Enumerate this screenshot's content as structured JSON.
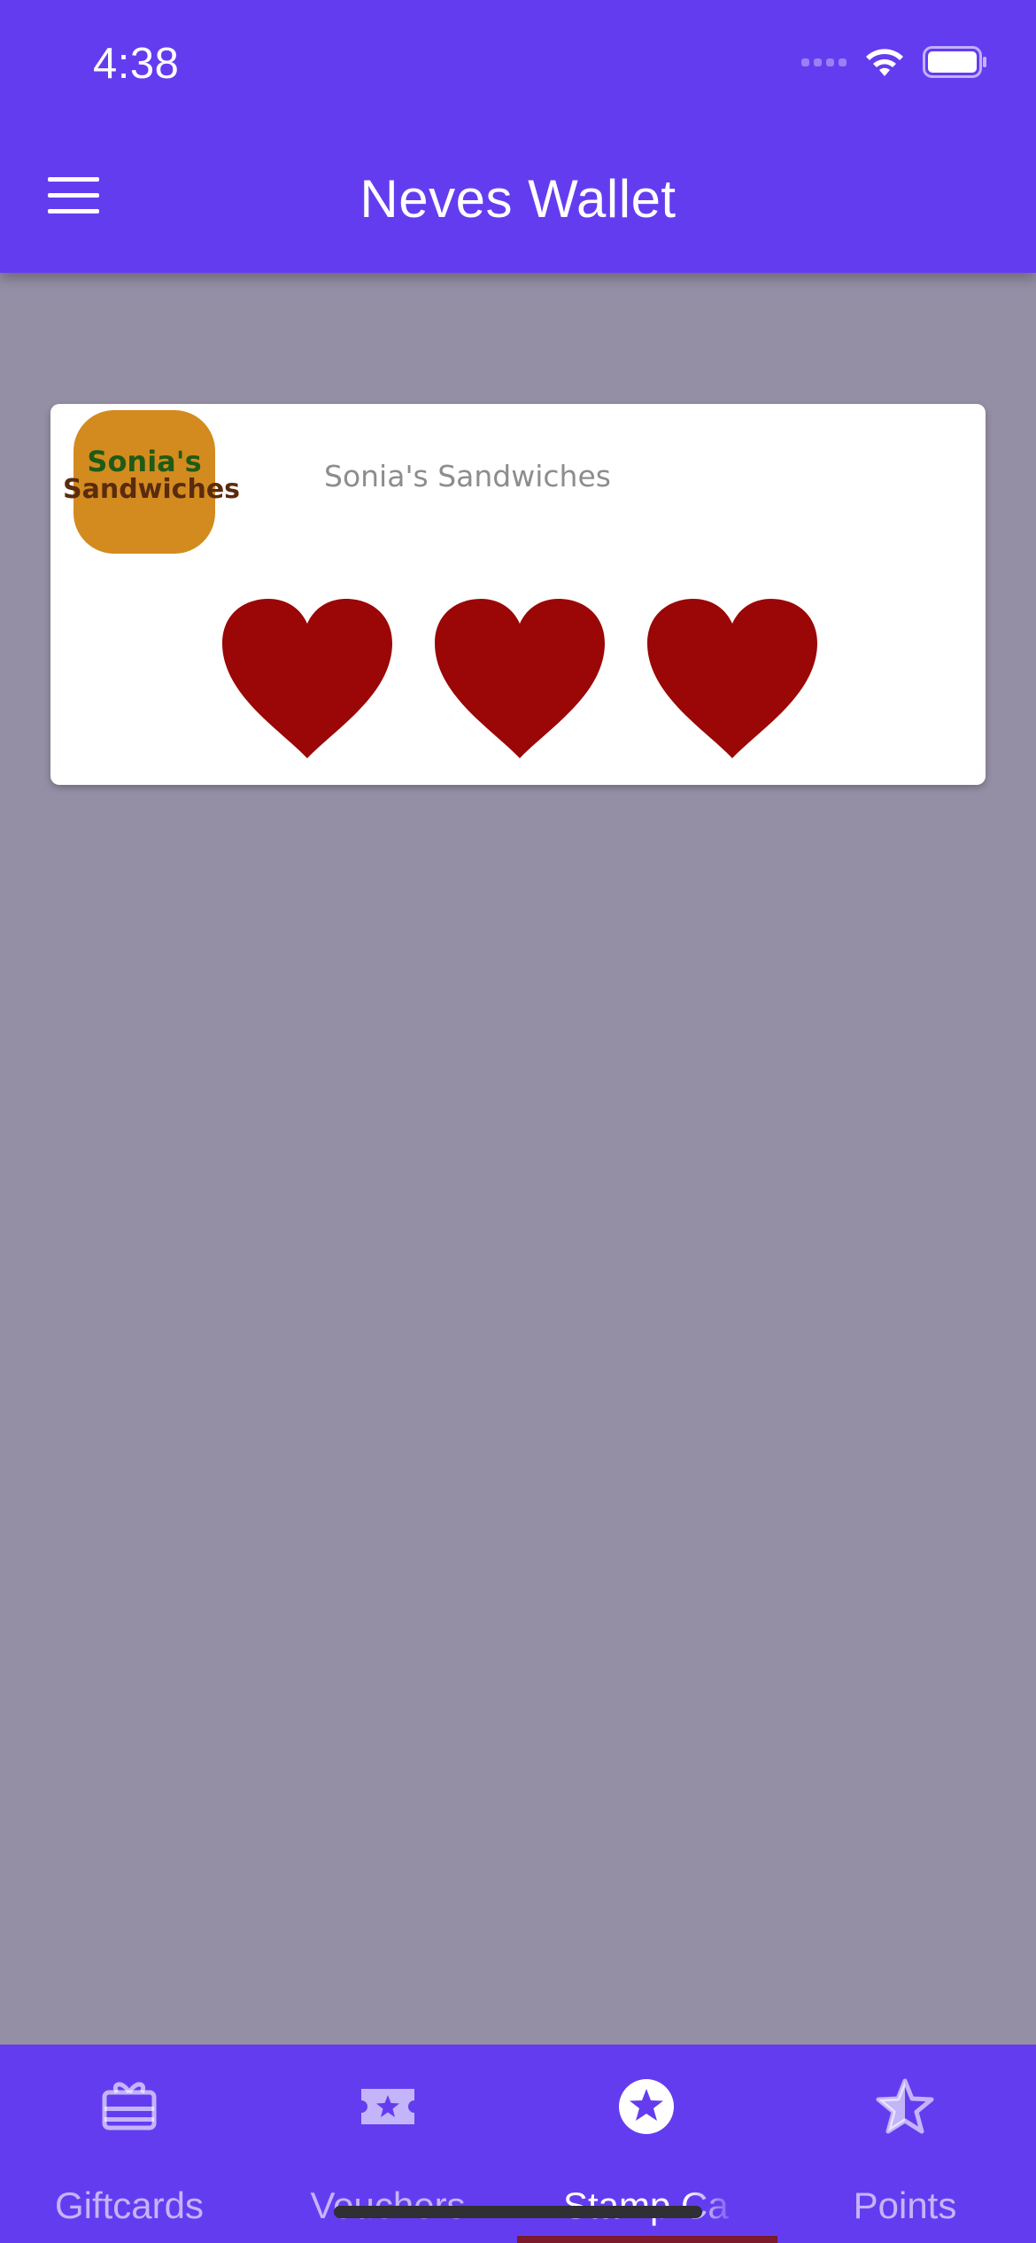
{
  "status_bar": {
    "time": "4:38"
  },
  "app_bar": {
    "title": "Neves Wallet",
    "menu_icon": "hamburger-menu-icon"
  },
  "stamp_cards": [
    {
      "merchant_name": "Sonia's Sandwiches",
      "logo_lines": [
        "Sonia's",
        "Sandwiches"
      ],
      "logo_color": "#d38b20",
      "stamp_icon": "heart-icon",
      "stamp_color": "#9b0606",
      "stamps_collected": 3
    }
  ],
  "bottom_nav": {
    "items": [
      {
        "label": "Giftcards",
        "icon": "gift-card-icon"
      },
      {
        "label": "Vouchers",
        "icon": "ticket-star-icon"
      },
      {
        "label": "Stamp Ca",
        "icon": "star-circle-icon",
        "active": true
      },
      {
        "label": "Points",
        "icon": "star-half-icon"
      }
    ]
  },
  "colors": {
    "primary": "#643cf0",
    "background": "#958fa6",
    "card": "#ffffff",
    "nav_inactive": "rgba(255,255,255,0.62)"
  }
}
